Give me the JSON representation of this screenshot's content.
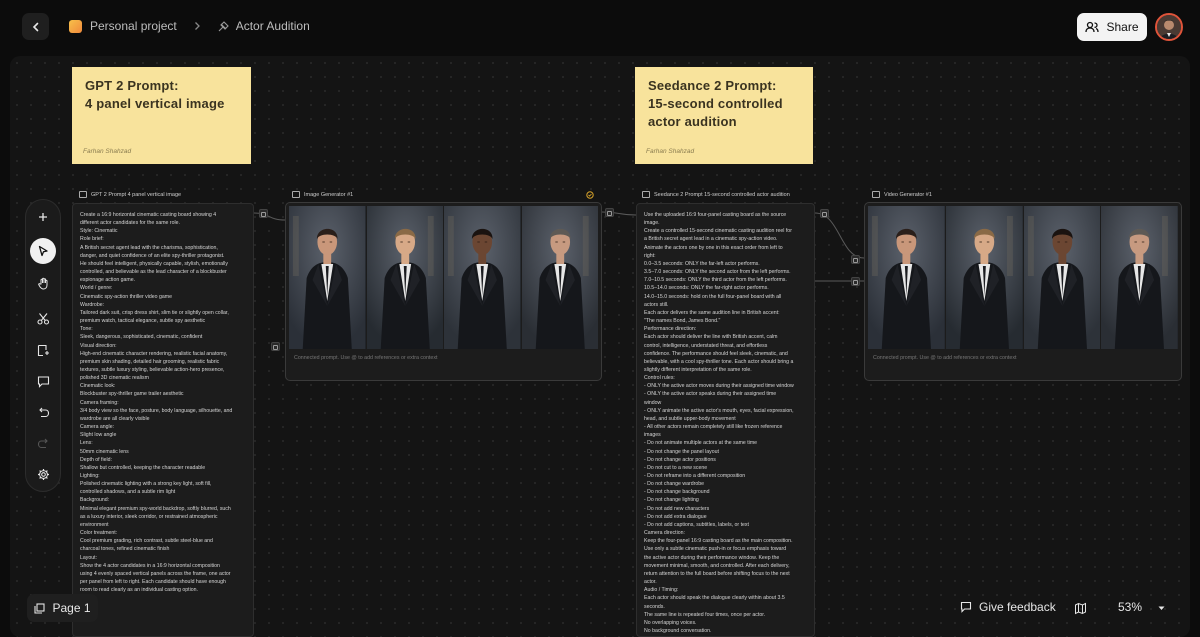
{
  "breadcrumb": {
    "project": "Personal project",
    "page": "Actor Audition"
  },
  "share_label": "Share",
  "sticky_notes": [
    {
      "title": "GPT 2 Prompt:\n4 panel vertical image",
      "author": "Farhan Shahzad"
    },
    {
      "title": "Seedance 2 Prompt:\n15-second controlled\nactor audition",
      "author": "Farhan Shahzad"
    }
  ],
  "nodes": {
    "gpt_prompt": {
      "label": "GPT 2 Prompt 4 panel vertical image",
      "lines": [
        "Create a 16:9 horizontal cinematic casting board showing 4",
        "different actor candidates for the same role.",
        "Style: Cinematic",
        "Role brief:",
        "A British secret agent lead with the charisma, sophistication,",
        "danger, and quiet confidence of an elite spy-thriller protagonist.",
        "He should feel intelligent, physically capable, stylish, emotionally",
        "controlled, and believable as the lead character of a blockbuster",
        "espionage action game.",
        "World / genre:",
        "Cinematic spy-action thriller video game",
        "Wardrobe:",
        "Tailored dark suit, crisp dress shirt, slim tie or slightly open collar,",
        "premium watch, tactical elegance, subtle spy aesthetic",
        "Tone:",
        "Sleek, dangerous, sophisticated, cinematic, confident",
        "Visual direction:",
        "High-end cinematic character rendering, realistic facial anatomy,",
        "premium skin shading, detailed hair grooming, realistic fabric",
        "textures, subtle luxury styling, believable action-hero presence,",
        "polished 3D cinematic realism",
        "Cinematic look:",
        "Blockbuster spy-thriller game trailer aesthetic",
        "Camera framing:",
        "3/4 body view so the face, posture, body language, silhouette, and",
        "wardrobe are all clearly visible",
        "Camera angle:",
        "Slight low angle",
        "Lens:",
        "50mm cinematic lens",
        "Depth of field:",
        "Shallow but controlled, keeping the character readable",
        "Lighting:",
        "Polished cinematic lighting with a strong key light, soft fill,",
        "controlled shadows, and a subtle rim light",
        "Background:",
        "Minimal elegant premium spy-world backdrop, softly blurred, such",
        "as a luxury interior, sleek corridor, or restrained atmospheric",
        "environment",
        "Color treatment:",
        "Cool premium grading, rich contrast, subtle steel-blue and",
        "charcoal tones, refined cinematic finish",
        "Layout:",
        "Show the 4 actor candidates in a 16:9 horizontal composition",
        "using 4 evenly spaced vertical panels across the frame, one actor",
        "per panel from left to right. Each candidate should have enough",
        "room to read clearly as an individual casting option."
      ]
    },
    "image_generator": {
      "label": "Image Generator #1",
      "prompt_hint": "Connected prompt. Use @ to add references or extra context"
    },
    "seedance_prompt": {
      "label": "Seedance 2 Prompt 15-second controlled actor audition",
      "lines": [
        "Use the uploaded 16:9 four-panel casting board as the source",
        "image.",
        "Create a controlled 15-second cinematic casting audition reel for",
        "a British secret agent lead in a cinematic spy-action video.",
        "Animate the actors one by one in this exact order from left to",
        "right:",
        "0.0–3.5 seconds: ONLY the far-left actor performs.",
        "3.5–7.0 seconds: ONLY the second actor from the left performs.",
        "7.0–10.5 seconds: ONLY the third actor from the left performs.",
        "10.5–14.0 seconds: ONLY the far-right actor performs.",
        "14.0–15.0 seconds: hold on the full four-panel board with all",
        "actors still.",
        "Each actor delivers the same audition line in British accent:",
        "\"The names Bond, James Bond.\"",
        "Performance direction:",
        "Each actor should deliver the line with British accent, calm",
        "control, intelligence, understated threat, and effortless",
        "confidence. The performance should feel sleek, cinematic, and",
        "believable, with a cool spy-thriller tone. Each actor should bring a",
        "slightly different interpretation of the same role.",
        "Control rules:",
        "- ONLY the active actor moves during their assigned time window",
        "- ONLY the active actor speaks during their assigned time",
        "window",
        "- ONLY animate the active actor's mouth, eyes, facial expression,",
        "head, and subtle upper-body movement",
        "- All other actors remain completely still like frozen reference",
        "images",
        "- Do not animate multiple actors at the same time",
        "- Do not change the panel layout",
        "- Do not change actor positions",
        "- Do not cut to a new scene",
        "- Do not reframe into a different composition",
        "- Do not change wardrobe",
        "- Do not change background",
        "- Do not change lighting",
        "- Do not add new characters",
        "- Do not add extra dialogue",
        "- Do not add captions, subtitles, labels, or text",
        "Camera direction:",
        "Keep the four-panel 16:9 casting board as the main composition.",
        "Use only a subtle cinematic push-in or focus emphasis toward",
        "the active actor during their performance window. Keep the",
        "movement minimal, smooth, and controlled. After each delivery,",
        "return attention to the full board before shifting focus to the next",
        "actor.",
        "Audio / Timing:",
        "Each actor should speak the dialogue clearly within about 3.5",
        "seconds.",
        "The same line is repeated four times, once per actor.",
        "No overlapping voices.",
        "No background conversation."
      ]
    },
    "video_generator": {
      "label": "Video Generator #1",
      "prompt_hint": "Connected prompt. Use @ to add references or extra context"
    }
  },
  "page_label": "Page 1",
  "feedback_label": "Give feedback",
  "zoom_label": "53%",
  "colors": {
    "sticky": "#f8e39c",
    "avatar_ring": "#e0543a",
    "canvas": "#141414",
    "share_bg": "#f3f3f3"
  },
  "icons": [
    "back-arrow-icon",
    "project-icon",
    "chevron-right-icon",
    "actor-audition-icon",
    "share-icon",
    "plus-icon",
    "pointer-icon",
    "hand-icon",
    "scissors-icon",
    "sticky-note-icon",
    "comment-icon",
    "undo-icon",
    "redo-icon",
    "settings-icon",
    "pages-icon",
    "feedback-icon",
    "map-icon",
    "chevron-down-icon"
  ]
}
